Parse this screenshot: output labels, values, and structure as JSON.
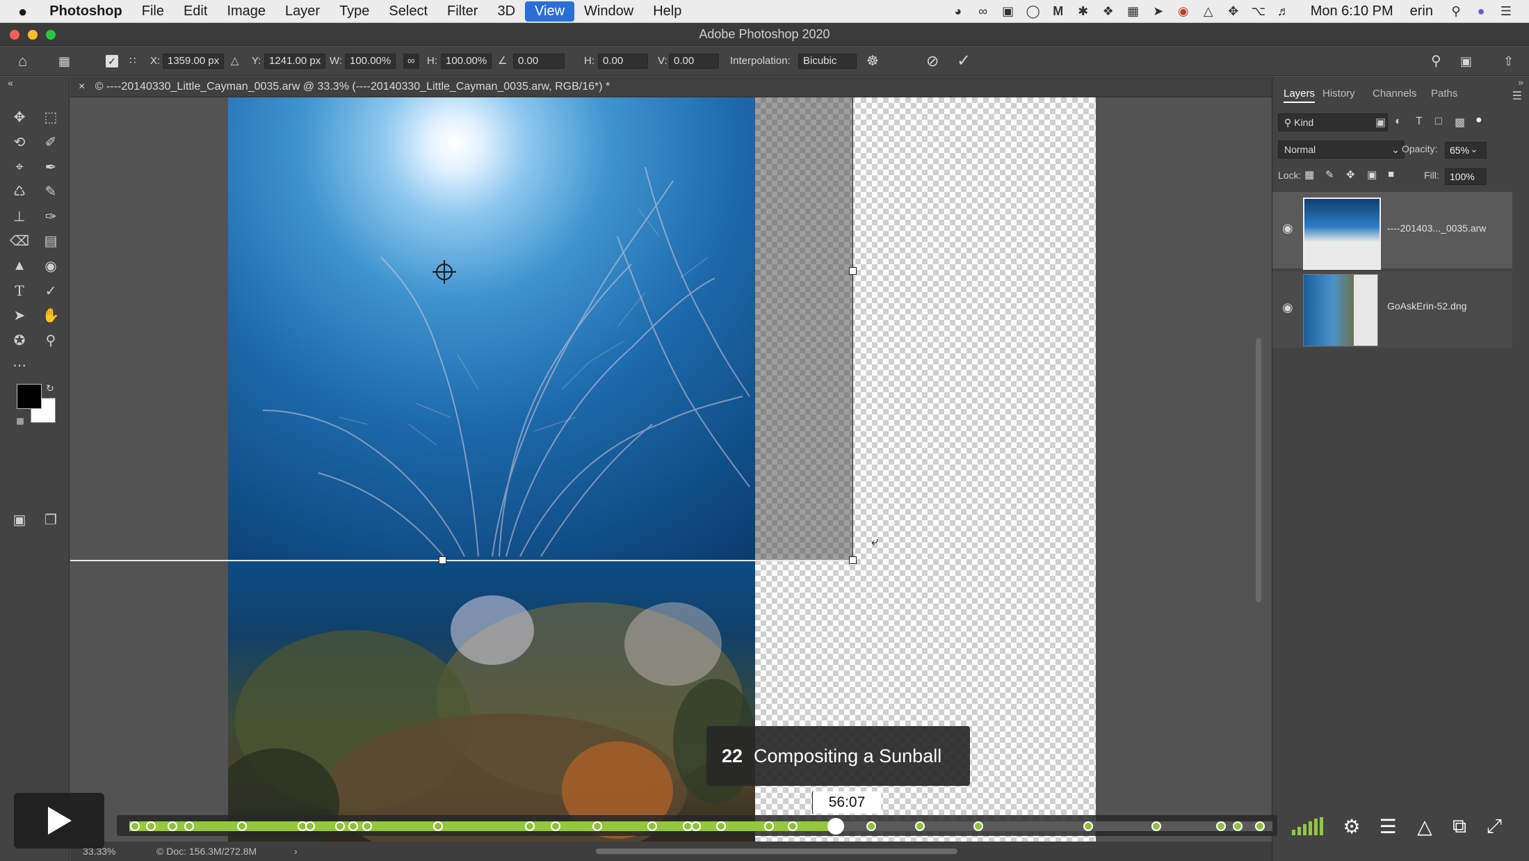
{
  "menubar": {
    "apple": "",
    "app": "Photoshop",
    "items": [
      "File",
      "Edit",
      "Image",
      "Layer",
      "Type",
      "Select",
      "Filter",
      "3D",
      "View",
      "Window",
      "Help"
    ],
    "active_index": 8,
    "clock": "Mon 6:10 PM",
    "user": "erin"
  },
  "window": {
    "title": "Adobe Photoshop 2020"
  },
  "options": {
    "x_label": "X:",
    "x_value": "1359.00 px",
    "y_label": "Y:",
    "y_value": "1241.00 px",
    "w_label": "W:",
    "w_value": "100.00%",
    "h_label": "H:",
    "h_value": "100.00%",
    "angle_value": "0.00",
    "hskew_label": "H:",
    "hskew_value": "0.00",
    "vskew_label": "V:",
    "vskew_value": "0.00",
    "interp_label": "Interpolation:",
    "interp_value": "Bicubic"
  },
  "document": {
    "tab_title": "© ----20140330_Little_Cayman_0035.arw @ 33.3% (----20140330_Little_Cayman_0035.arw, RGB/16*) *"
  },
  "layers_panel": {
    "tabs": [
      "Layers",
      "History",
      "Channels",
      "Paths"
    ],
    "selected_tab": 0,
    "filter_kind": "Kind",
    "blend_mode": "Normal",
    "opacity_label": "Opacity:",
    "opacity_value": "65%",
    "lock_label": "Lock:",
    "fill_label": "Fill:",
    "fill_value": "100%",
    "layers": [
      {
        "name": "----201403..._0035.arw",
        "selected": true
      },
      {
        "name": "GoAskErin-52.dng",
        "selected": false
      }
    ]
  },
  "status": {
    "zoom": "33.33%",
    "doc": "© Doc: 156.3M/272.8M"
  },
  "video": {
    "chapter_number": "22",
    "chapter_title": "Compositing a Sunball",
    "time": "56:07",
    "time_stub": "5"
  },
  "colors": {
    "accent": "#93c83e",
    "menu_highlight": "#2a6fd6"
  }
}
